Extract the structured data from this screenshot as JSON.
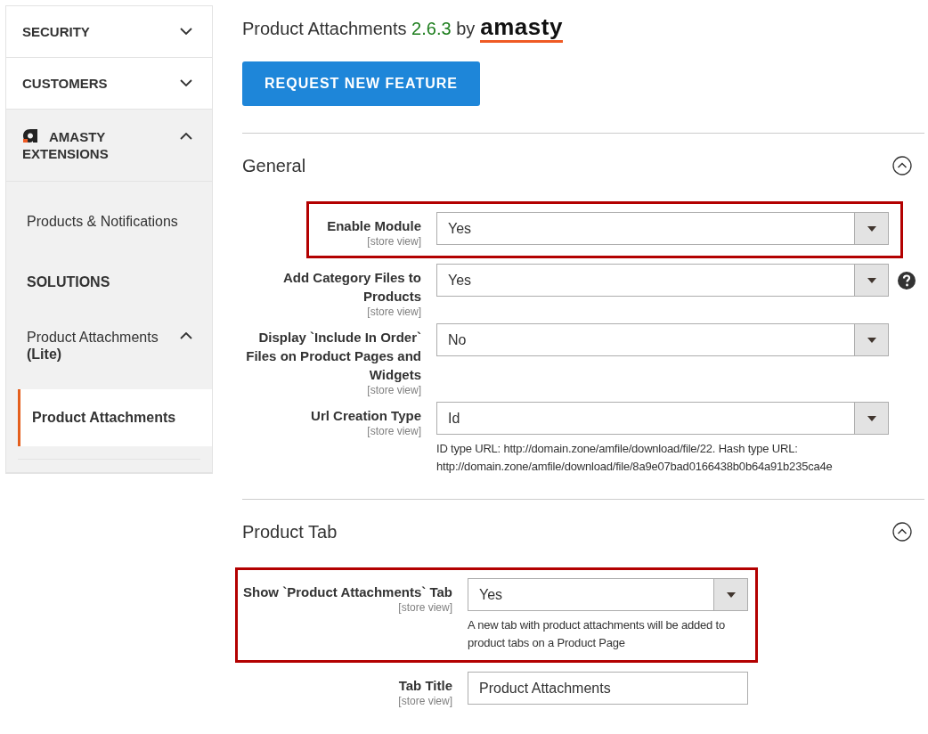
{
  "sidebar": {
    "sections": [
      {
        "label": "SECURITY",
        "kind": "core",
        "expanded": false
      },
      {
        "label": "CUSTOMERS",
        "kind": "core",
        "expanded": false
      },
      {
        "label": "AMASTY EXTENSIONS",
        "kind": "vendor",
        "expanded": true,
        "items": [
          {
            "kind": "link",
            "label": "Products & Notifications"
          },
          {
            "kind": "heading",
            "label": "SOLUTIONS"
          },
          {
            "kind": "group",
            "label": "Product Attachments",
            "suffix": "(Lite)",
            "expanded": true,
            "children": [
              {
                "label": "Product Attachments",
                "selected": true
              }
            ]
          }
        ]
      }
    ]
  },
  "header": {
    "title": "Product Attachments",
    "version": "2.6.3",
    "by": "by",
    "brand": "amasty"
  },
  "request_button": "REQUEST NEW FEATURE",
  "sections": [
    {
      "title": "General",
      "expanded": true,
      "kind": "wide",
      "fields": [
        {
          "label": "Enable Module",
          "scope": "[store view]",
          "kind": "select",
          "value": "Yes",
          "highlighted": true,
          "help": false
        },
        {
          "label": "Add Category Files to Products",
          "scope": "[store view]",
          "kind": "select",
          "value": "Yes",
          "highlighted": false,
          "help": true
        },
        {
          "label": "Display `Include In Order` Files on Product Pages and Widgets",
          "scope": "[store view]",
          "kind": "select",
          "value": "No",
          "highlighted": false,
          "help": false
        },
        {
          "label": "Url Creation Type",
          "scope": "[store view]",
          "kind": "select",
          "value": "Id",
          "highlighted": false,
          "help": false,
          "note": "ID type URL: http://domain.zone/amfile/download/file/22. Hash type URL: http://domain.zone/amfile/download/file/8a9e07bad0166438b0b64a91b235ca4e"
        }
      ]
    },
    {
      "title": "Product Tab",
      "expanded": true,
      "kind": "narrow",
      "fields": [
        {
          "label": "Show `Product Attachments` Tab",
          "scope": "[store view]",
          "kind": "select",
          "value": "Yes",
          "highlighted": true,
          "help": false,
          "note": "A new tab with product attachments will be added to product tabs on a Product Page"
        },
        {
          "label": "Tab Title",
          "scope": "[store view]",
          "kind": "text",
          "value": "Product Attachments",
          "highlighted": false,
          "help": false
        }
      ]
    }
  ]
}
